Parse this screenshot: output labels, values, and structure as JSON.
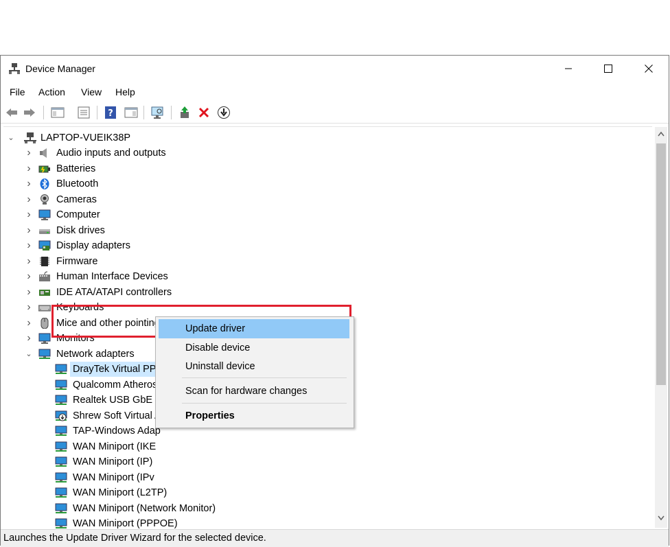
{
  "window": {
    "title": "Device Manager",
    "controls": [
      "minimize",
      "maximize",
      "close"
    ]
  },
  "menu": [
    "File",
    "Action",
    "View",
    "Help"
  ],
  "toolbar": [
    "back",
    "forward",
    "properties-view",
    "properties",
    "help",
    "show-hide",
    "scan-monitor",
    "update-driver",
    "uninstall",
    "download"
  ],
  "tree": {
    "root": "LAPTOP-VUEIK38P",
    "categories": [
      {
        "label": "Audio inputs and outputs",
        "icon": "speaker-icon"
      },
      {
        "label": "Batteries",
        "icon": "battery-icon"
      },
      {
        "label": "Bluetooth",
        "icon": "bluetooth-icon"
      },
      {
        "label": "Cameras",
        "icon": "camera-icon"
      },
      {
        "label": "Computer",
        "icon": "monitor-icon"
      },
      {
        "label": "Disk drives",
        "icon": "disk-icon"
      },
      {
        "label": "Display adapters",
        "icon": "display-adapter-icon"
      },
      {
        "label": "Firmware",
        "icon": "chip-icon"
      },
      {
        "label": "Human Interface Devices",
        "icon": "hid-icon"
      },
      {
        "label": "IDE ATA/ATAPI controllers",
        "icon": "ide-icon"
      },
      {
        "label": "Keyboards",
        "icon": "keyboard-icon"
      },
      {
        "label": "Mice and other pointing devices",
        "icon": "mouse-icon"
      },
      {
        "label": "Monitors",
        "icon": "monitor-icon"
      },
      {
        "label": "Network adapters",
        "icon": "network-icon"
      }
    ],
    "network_adapters": [
      "DrayTek Virtual PPP Adapter",
      "Qualcomm Atheros",
      "Realtek USB GbE Fa",
      "Shrew Soft Virtual A",
      "TAP-Windows Adap",
      "WAN Miniport (IKE",
      "WAN Miniport (IP)",
      "WAN Miniport (IPv",
      "WAN Miniport (L2TP)",
      "WAN Miniport (Network Monitor)",
      "WAN Miniport (PPPOE)"
    ]
  },
  "context_menu": {
    "items": [
      "Update driver",
      "Disable device",
      "Uninstall device",
      "Scan for hardware changes",
      "Properties"
    ]
  },
  "status": "Launches the Update Driver Wizard for the selected device.",
  "colors": {
    "selection": "#cce8ff",
    "menu_highlight": "#91c9f7",
    "annotation_red": "#e0202e",
    "adapter_icon": "#1e90d6"
  }
}
